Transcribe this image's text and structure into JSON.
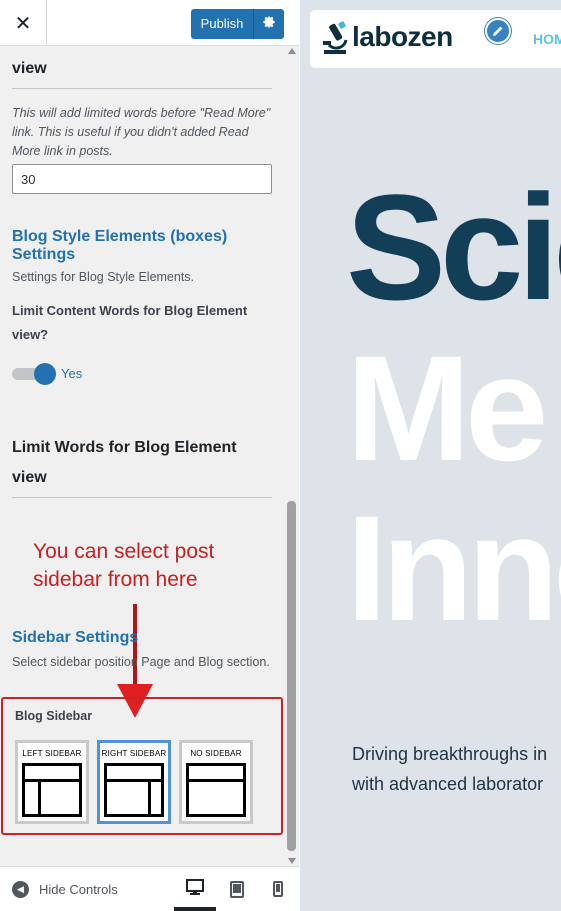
{
  "customizer": {
    "close_icon": "close-icon",
    "publish_label": "Publish",
    "prev_section": {
      "title": "view",
      "description": "This will add limited words before \"Read More\" link. This is useful if you didn't added Read More link in posts.",
      "input_value": "30"
    },
    "blog_elements": {
      "title": "Blog Style Elements (boxes) Settings",
      "description": "Settings for Blog Style Elements.",
      "limit_label": "Limit Content Words for Blog Element view?",
      "toggle_value": "Yes",
      "toggle_on": true,
      "words_title": "Limit Words for Blog Element view"
    },
    "annotation": "You can select post sidebar from here",
    "sidebar_settings": {
      "title": "Sidebar Settings",
      "description": "Select sidebar position Page and Blog section.",
      "blog_sidebar_label": "Blog Sidebar",
      "options": [
        {
          "label": "LEFT SIDEBAR",
          "selected": false
        },
        {
          "label": "RIGHT SIDEBAR",
          "selected": true
        },
        {
          "label": "NO SIDEBAR",
          "selected": false
        }
      ]
    },
    "footer": {
      "hide_controls": "Hide Controls",
      "devices": [
        "desktop-icon",
        "tablet-icon",
        "mobile-icon"
      ],
      "active_device": "desktop"
    }
  },
  "preview": {
    "logo_text": "labozen",
    "nav_home": "HOM",
    "hero": [
      "Scie",
      "Me",
      "Inno"
    ],
    "tagline": [
      "Driving breakthroughs in",
      "with advanced laborator"
    ]
  },
  "colors": {
    "accent": "#2271b1",
    "annotation": "#cc1e1e",
    "hero_dark": "#123f57",
    "preview_bg": "#dee3ea"
  }
}
